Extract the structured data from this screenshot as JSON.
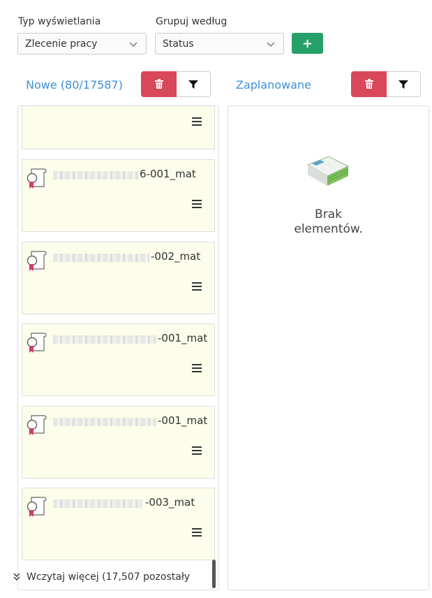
{
  "filters": {
    "display_type_label": "Typ wyświetlania",
    "display_type_value": "Zlecenie pracy",
    "group_by_label": "Grupuj według",
    "group_by_value": "Status",
    "add_label": "+"
  },
  "columns": [
    {
      "title": "Nowe (80/17587)",
      "cards": [
        {
          "suffix": ""
        },
        {
          "suffix": "6-001_mat"
        },
        {
          "suffix": "-002_mat"
        },
        {
          "suffix": "-001_mat"
        },
        {
          "suffix": "-001_mat"
        },
        {
          "suffix": "-003_mat"
        }
      ],
      "load_more": "Wczytaj więcej (17,507 pozostały"
    },
    {
      "title": "Zaplanowane",
      "empty_line1": "Brak",
      "empty_line2": "elementów."
    }
  ],
  "colors": {
    "accent_blue": "#3f8fd6",
    "delete_red": "#d9475a",
    "add_green": "#26a069",
    "card_bg": "#fdfdeb"
  }
}
